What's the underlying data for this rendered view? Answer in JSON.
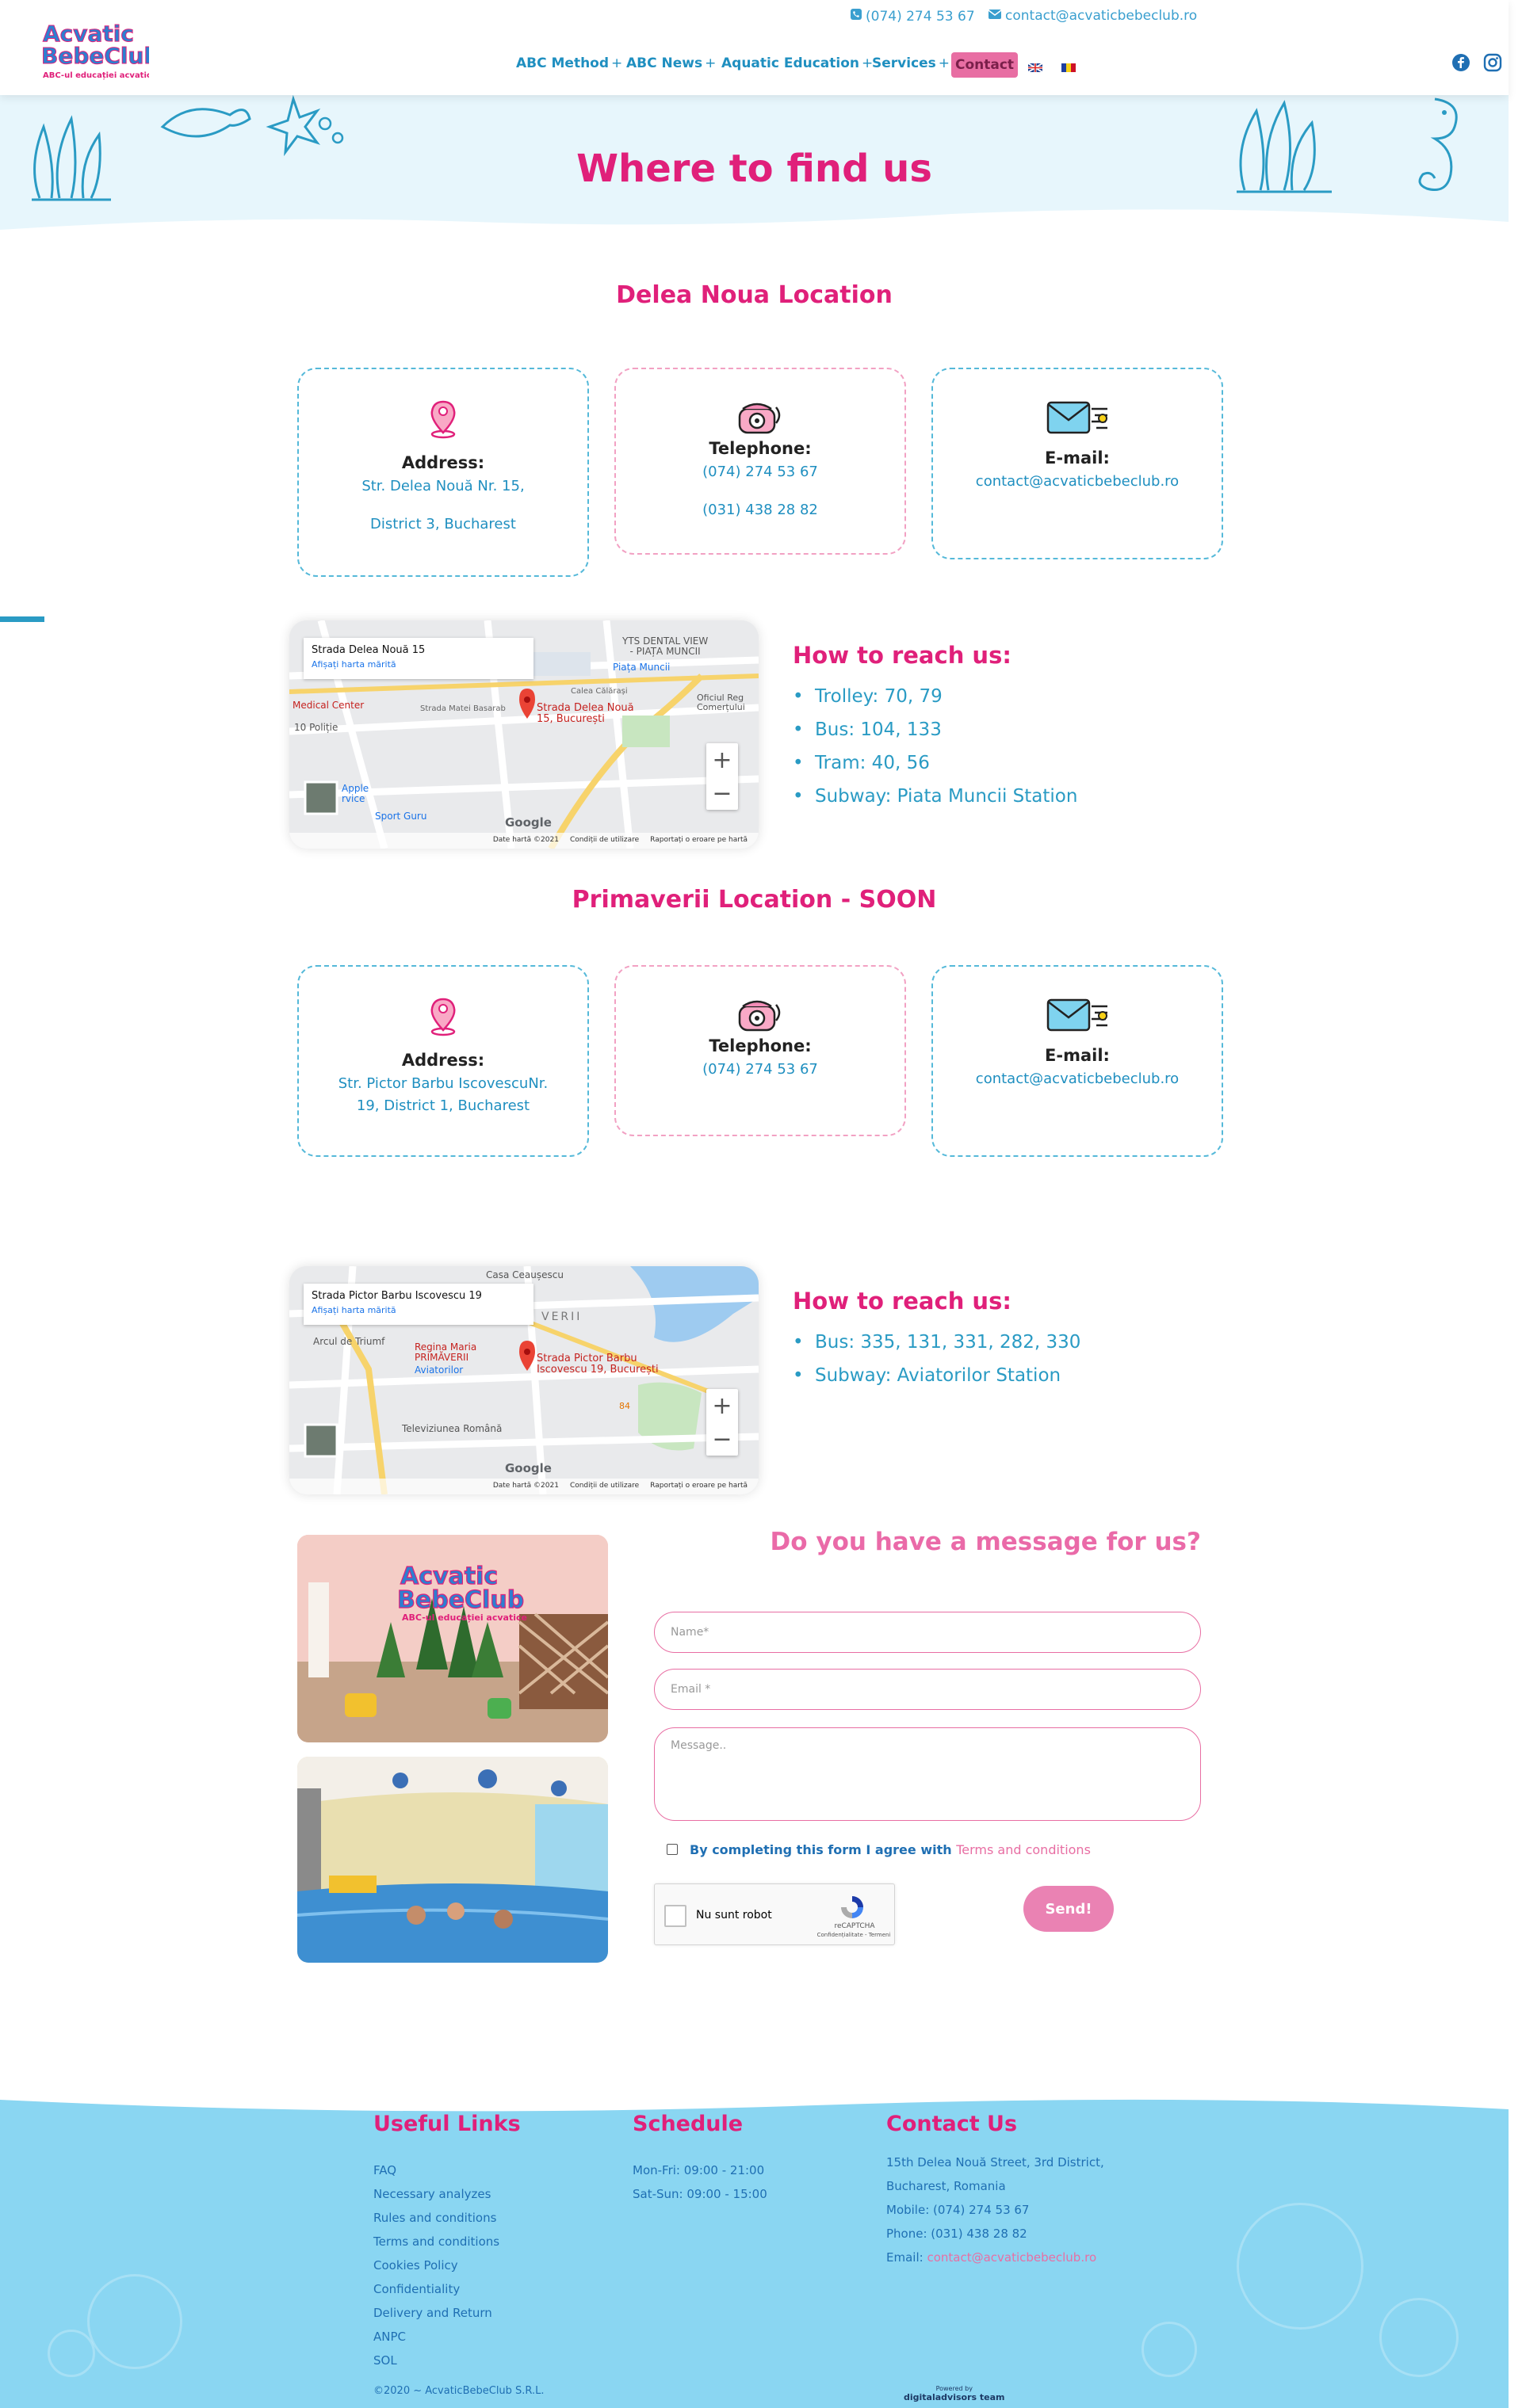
{
  "header": {
    "logo_line1": "Acvatic",
    "logo_line2": "BebeClub",
    "logo_tagline": "ABC-ul educației acvatice",
    "phone": "(074) 274 53 67",
    "email": "contact@acvaticbebeclub.ro",
    "nav": [
      {
        "label": "ABC Method",
        "plus": "+"
      },
      {
        "label": "ABC News",
        "plus": "+"
      },
      {
        "label": "Aquatic Education",
        "plus": "+"
      },
      {
        "label": "Services",
        "plus": "+"
      }
    ],
    "nav_active": "Contact"
  },
  "hero": {
    "title": "Where to find us"
  },
  "location1": {
    "title": "Delea Noua Location",
    "address_label": "Address:",
    "address_line1": "Str. Delea Nouă Nr. 15,",
    "address_line2": "District 3, Bucharest",
    "phone_label": "Telephone:",
    "phone1": "(074) 274 53 67",
    "phone2": "(031) 438 28 82",
    "email_label": "E-mail:",
    "email": "contact@acvaticbebeclub.ro",
    "map": {
      "info_title": "Strada Delea Nouă 15",
      "info_link": "Afișați harta mărită",
      "pin_label_1": "Strada Delea Nouă",
      "pin_label_2": "15, București",
      "labels": [
        "YTS DENTAL VIEW",
        "- PIAȚA MUNCII",
        "Piața Muncii",
        "Oficiul Reg",
        "Comerțului",
        "Medical Center",
        "10 Poliție",
        "Apple",
        "rvice",
        "Sport Guru",
        "Strada Matei Basarab",
        "Calea Călărași"
      ],
      "google": "Google",
      "footer": [
        "Date hartă ©2021",
        "Condiții de utilizare",
        "Raportați o eroare pe hartă"
      ]
    },
    "reach_title": "How to reach us:",
    "reach": [
      "Trolley: 70, 79",
      "Bus: 104, 133",
      "Tram: 40, 56",
      "Subway: Piata Muncii Station"
    ]
  },
  "location2": {
    "title": "Primaverii Location - SOON",
    "address_label": "Address:",
    "address_line1": "Str. Pictor Barbu IscovescuNr.",
    "address_line2": "19, District 1, Bucharest",
    "phone_label": "Telephone:",
    "phone1": "(074) 274 53 67",
    "email_label": "E-mail:",
    "email": "contact@acvaticbebeclub.ro",
    "map": {
      "info_title": "Strada Pictor Barbu Iscovescu 19",
      "info_link": "Afișați harta mărită",
      "pin_label_1": "Strada Pictor Barbu",
      "pin_label_2": "Iscovescu 19, București",
      "labels": [
        "Casa Ceaușescu",
        "VERII",
        "Regina Maria",
        "PRIMĂVERII",
        "Aviatorilor",
        "Arcul de Triumf",
        "Televiziunea Română",
        "84"
      ],
      "google": "Google",
      "footer": [
        "Date hartă ©2021",
        "Condiții de utilizare",
        "Raportați o eroare pe hartă"
      ]
    },
    "reach_title": "How to reach us:",
    "reach": [
      "Bus: 335, 131, 331, 282, 330",
      "Subway: Aviatorilor Station"
    ]
  },
  "contact_form": {
    "title": "Do you have a message for us?",
    "name_placeholder": "Name*",
    "email_placeholder": "Email *",
    "message_placeholder": "Message..",
    "consent_text": "By completing this form I agree with",
    "consent_link": "Terms and conditions",
    "captcha_label": "Nu sunt robot",
    "captcha_brand": "reCAPTCHA",
    "captcha_links": "Confidențialitate - Termeni",
    "send": "Send!"
  },
  "photos": {
    "sign_line1": "Acvatic",
    "sign_line2": "BebeClub",
    "sign_tagline": "ABC-ul educației acvatice"
  },
  "footer": {
    "useful_title": "Useful Links",
    "links": [
      "FAQ",
      "Necessary analyzes",
      "Rules and conditions",
      "Terms and conditions",
      "Cookies Policy",
      "Confidentiality",
      "Delivery and Return",
      "ANPC",
      "SOL"
    ],
    "schedule_title": "Schedule",
    "schedule": [
      "Mon-Fri: 09:00 - 21:00",
      "Sat-Sun: 09:00 - 15:00"
    ],
    "contact_title": "Contact Us",
    "contact": [
      "15th Delea Nouă Street, 3rd District,",
      "Bucharest, Romania",
      "Mobile: (074) 274 53 67",
      "Phone: (031) 438 28 82"
    ],
    "email_label": "Email:",
    "email": "contact@acvaticbebeclub.ro",
    "copyright": "©2020 ~ AcvaticBebeClub S.R.L.",
    "credit_small": "Powered by",
    "credit": "digitaladvisors team"
  },
  "colors": {
    "pink": "#e0207a",
    "blue": "#2a9bc4",
    "light_blue": "#e7f6fc",
    "footer_blue": "#8ad6f2"
  }
}
